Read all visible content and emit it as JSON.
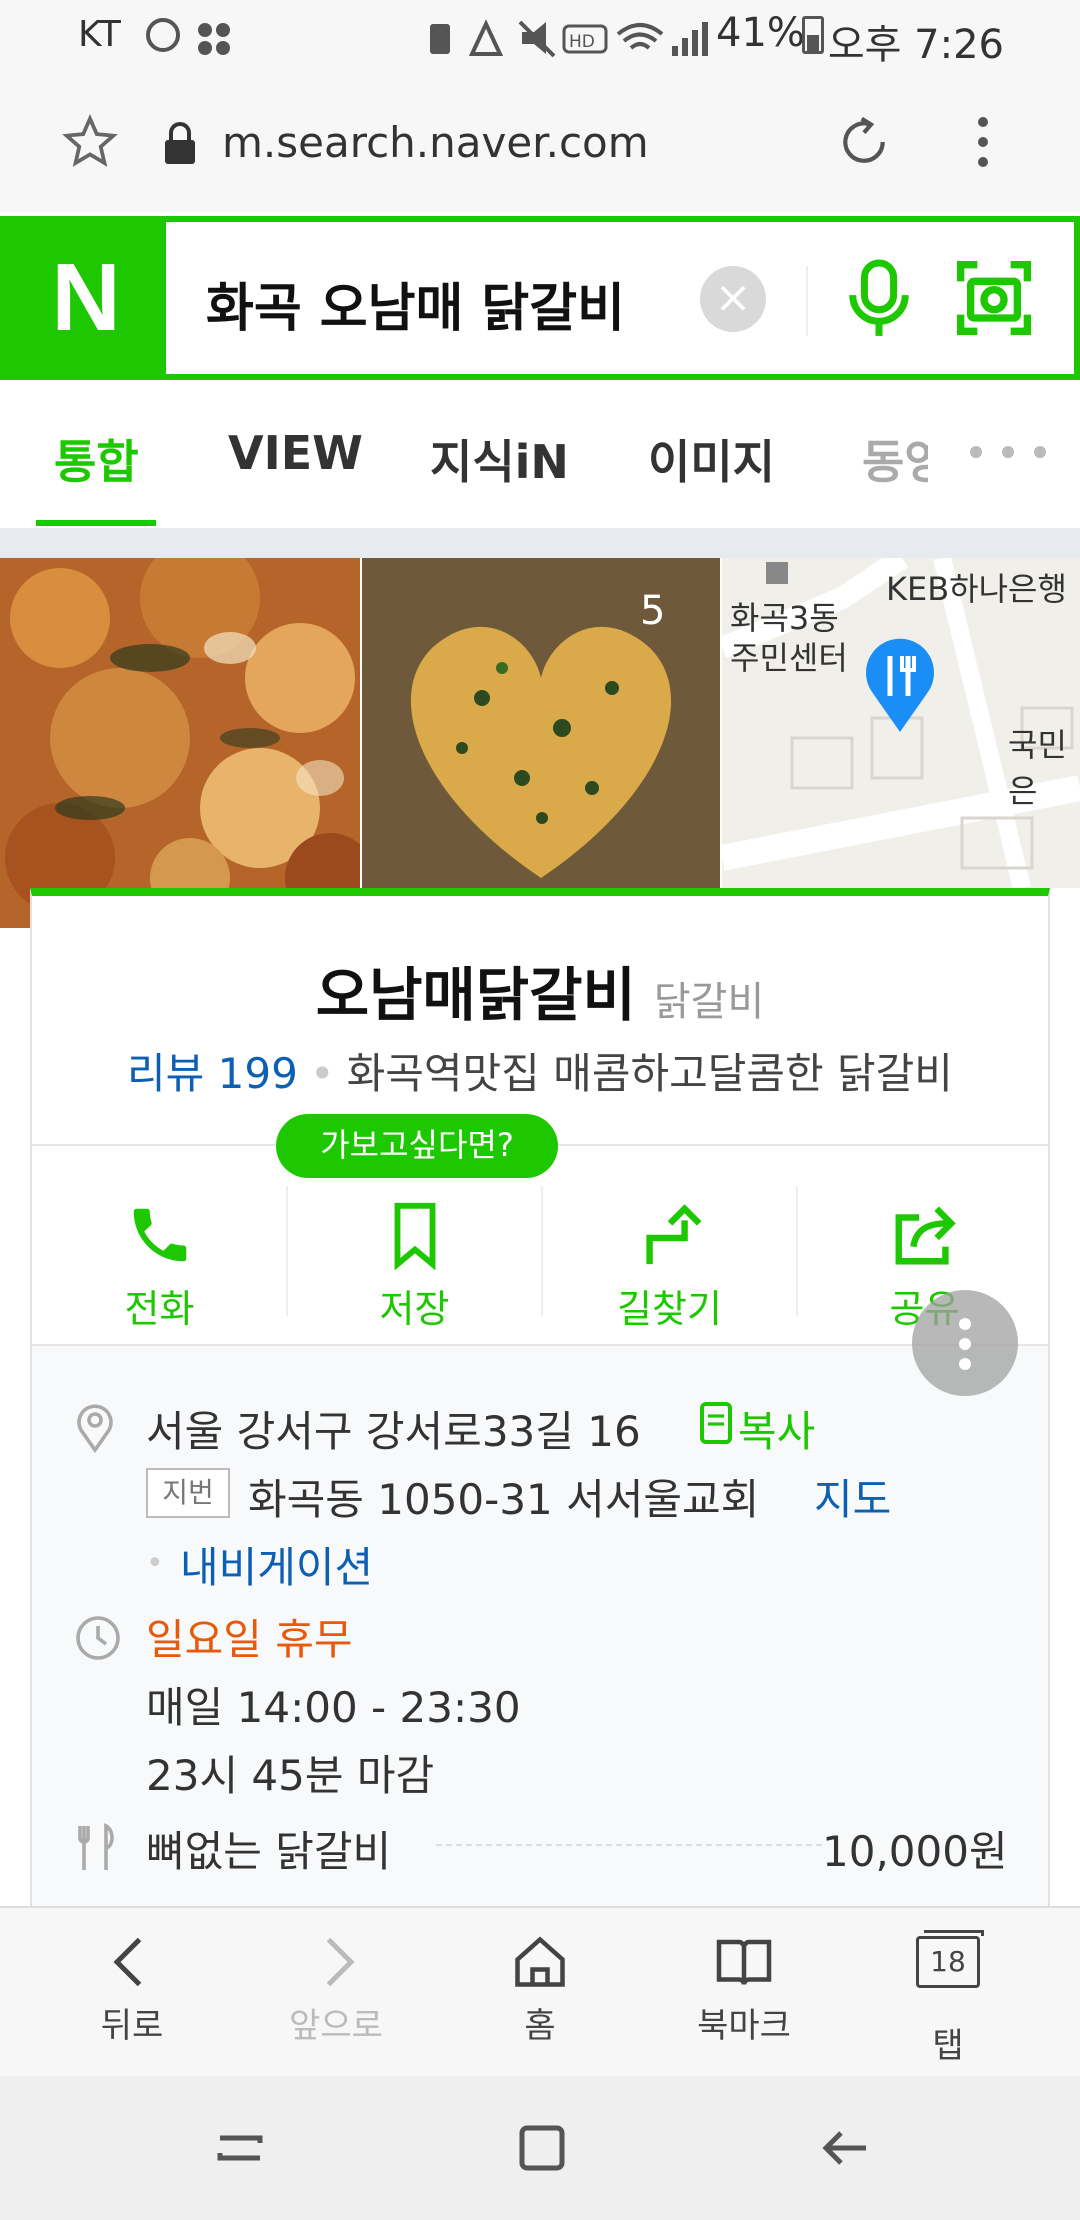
{
  "status_bar": {
    "carrier": "KT",
    "battery": "41%",
    "time": "오후 7:26"
  },
  "browser": {
    "url": "m.search.naver.com"
  },
  "search": {
    "logo": "N",
    "query": "화곡 오남매 닭갈비"
  },
  "tabs": [
    {
      "label": "통합",
      "active": true
    },
    {
      "label": "VIEW"
    },
    {
      "label": "지식iN"
    },
    {
      "label": "이미지"
    },
    {
      "label": "동영상"
    }
  ],
  "photos": {
    "count_badge": "5",
    "map_labels": [
      "KEB하나은행",
      "화곡3동\n주민센터",
      "국민은"
    ]
  },
  "place": {
    "name": "오남매닭갈비",
    "category": "닭갈비",
    "review_label": "리뷰 199",
    "tagline": "화곡역맛집 매콤하고달콤한 닭갈비",
    "tooltip": "가보고싶다면?",
    "actions": [
      {
        "label": "전화",
        "icon": "phone-icon"
      },
      {
        "label": "저장",
        "icon": "bookmark-icon"
      },
      {
        "label": "길찾기",
        "icon": "directions-icon"
      },
      {
        "label": "공유",
        "icon": "share-icon"
      }
    ],
    "address": "서울 강서구 강서로33길 16",
    "copy_label": "복사",
    "lot_tag": "지번",
    "lot_address": "화곡동 1050-31 서서울교회",
    "map_link": "지도",
    "navigation_link": "내비게이션",
    "closed_day": "일요일 휴무",
    "hours": "매일 14:00 - 23:30",
    "last_order": "23시 45분 마감",
    "menu_item": "뼈없는 닭갈비",
    "menu_price": "10,000원"
  },
  "toolbar": [
    {
      "label": "뒤로",
      "icon": "back-icon",
      "enabled": true
    },
    {
      "label": "앞으로",
      "icon": "forward-icon",
      "enabled": false
    },
    {
      "label": "홈",
      "icon": "home-icon",
      "enabled": true
    },
    {
      "label": "북마크",
      "icon": "bookmarks-icon",
      "enabled": true
    },
    {
      "label": "탭",
      "icon": "tabs-icon",
      "enabled": true,
      "count": "18"
    }
  ],
  "colors": {
    "naver_green": "#1ec800",
    "link_blue": "#0c5fb3",
    "closed_orange": "#e8590c"
  }
}
